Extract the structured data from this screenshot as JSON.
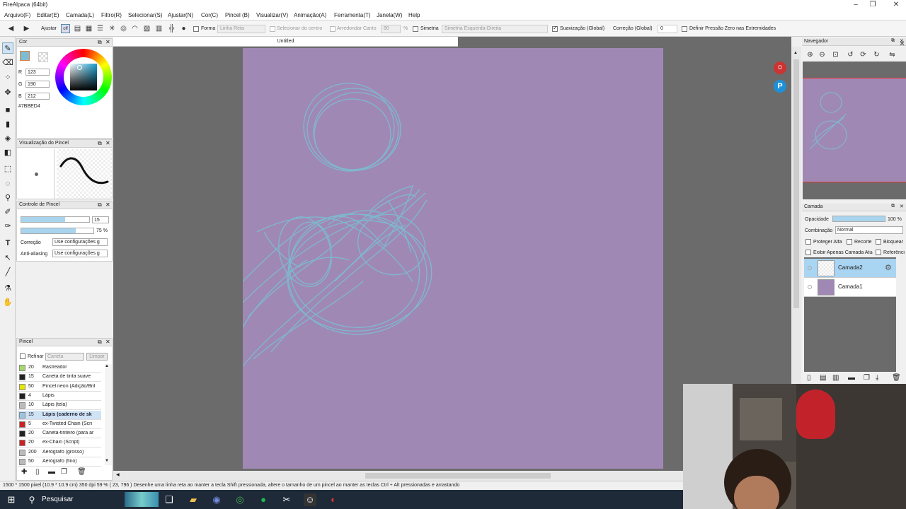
{
  "window": {
    "title": "FireAlpaca (64bit)",
    "doc_tab": "Untitled"
  },
  "menu": [
    "Arquivo(F)",
    "Editar(E)",
    "Camada(L)",
    "Filtro(R)",
    "Selecionar(S)",
    "Ajustar(N)",
    "Cor(C)",
    "Pincel (B)",
    "Visualizar(V)",
    "Animação(A)",
    "Ferramenta(T)",
    "Janela(W)",
    "Help"
  ],
  "toolopts": {
    "ajustar": "Ajustar",
    "off": "off",
    "forma": "Forma",
    "linha_reta": "Linha Reta",
    "selecionar_centro": "Selecionar do centro",
    "arredondar_canto": "Arredondar Canto",
    "arredondar_val": "80",
    "percent": "%",
    "simetria": "Simetria",
    "simetria_val": "Simetria Esquerda-Direita",
    "suavizacao": "Suavização (Global)",
    "correcao": "Correção (Global)",
    "correcao_val": "0",
    "pressao_zero": "Definir Pressão Zero nas Extremidades"
  },
  "color_panel": {
    "title": "Cor",
    "R_label": "R",
    "G_label": "G",
    "B_label": "B",
    "R": "123",
    "G": "190",
    "B": "212",
    "hex": "#7BBED4",
    "current_color": "#7bbed4"
  },
  "brush_preview": {
    "title": "Visualização do Pincel"
  },
  "brush_control": {
    "title": "Controle de Pincel",
    "size": "15",
    "size_fraction": 0.65,
    "opacity": "75 %",
    "opacity_fraction": 0.75,
    "correcao_label": "Correção",
    "correcao_val": "Use configurações g",
    "aa_label": "Anti-aliasing",
    "aa_val": "Use configurações g"
  },
  "brush_panel": {
    "title": "Pincel",
    "refinar": "Refinar",
    "caneta": "Caneta",
    "limpar": "Limpar",
    "items": [
      {
        "size": "20",
        "name": "Rastreador",
        "color": "#a7d86a"
      },
      {
        "size": "15",
        "name": "Caneta de tinta suave",
        "color": "#222222"
      },
      {
        "size": "50",
        "name": "Pincel neon (Adição/Bril",
        "color": "#e6e600"
      },
      {
        "size": "4",
        "name": "Lápis",
        "color": "#222222"
      },
      {
        "size": "10",
        "name": "Lápis (tela)",
        "color": "#bbbbbb"
      },
      {
        "size": "15",
        "name": "Lápis (caderno de sk",
        "color": "#9fc3dd"
      },
      {
        "size": "5",
        "name": "ex-Twisted Chain (Scri",
        "color": "#cc2222"
      },
      {
        "size": "20",
        "name": "Caneta-tinteiro (para ar",
        "color": "#222222"
      },
      {
        "size": "20",
        "name": "ex-Chain (Script)",
        "color": "#cc2222"
      },
      {
        "size": "200",
        "name": "Aerógrafo (grosso)",
        "color": "#bbbbbb"
      },
      {
        "size": "50",
        "name": "Aerógrafo (fino)",
        "color": "#bbbbbb"
      }
    ]
  },
  "navigator": {
    "title": "Navegador"
  },
  "layers": {
    "title": "Camada",
    "opacity_label": "Opacidade",
    "opacity_val": "100 %",
    "blend_label": "Combinação",
    "blend_val": "Normal",
    "protect": "Proteger Alfa",
    "clip": "Recorte",
    "lock": "Bloquear",
    "show_only": "Exibir Apenas Camada Atual",
    "ref": "Referência",
    "items": [
      {
        "name": "Camada2"
      },
      {
        "name": "Camada1"
      }
    ]
  },
  "status": "1500 * 1500 pixel  (10.9 * 10.9 cm)  350 dpi  59 %  ( 23, 796 )  Desenhe uma linha reta ao manter a tecla Shift pressionada, altere o tamanho de um pincel ao manter as teclas Ctrl + Alt pressionadas e arrastando",
  "taskbar": {
    "search": "Pesquisar"
  },
  "colors": {
    "canvas": "#a088b4",
    "stroke": "#7bbed4"
  }
}
